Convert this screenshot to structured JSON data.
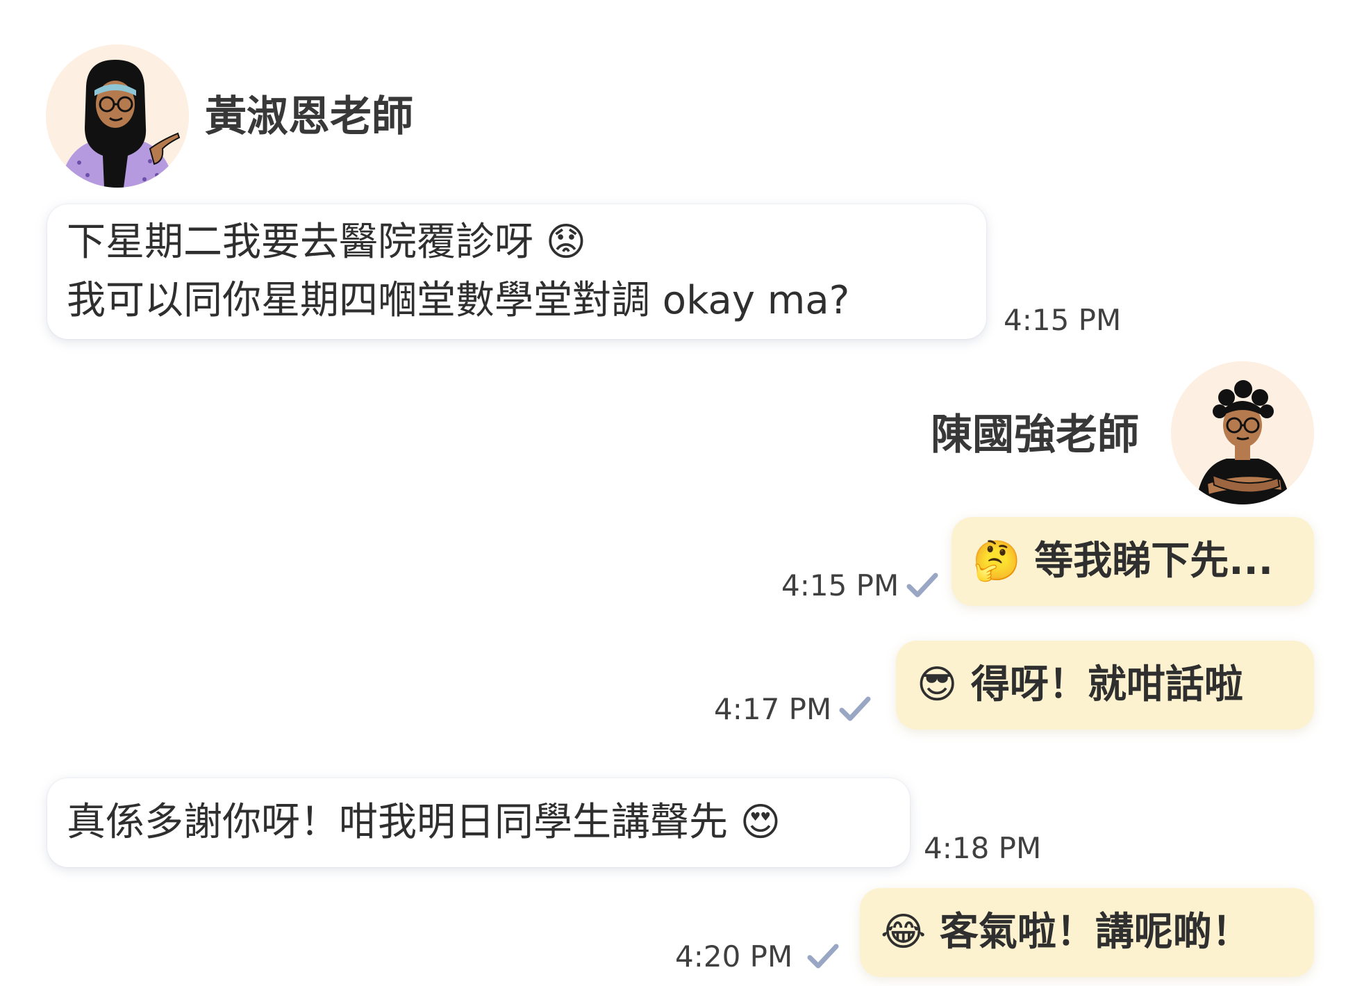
{
  "contacts": {
    "teacher_wong": {
      "name": "黃淑恩老師",
      "avatar_icon": "woman-hijab-pointing-avatar-icon"
    },
    "teacher_chan": {
      "name": "陳國強老師",
      "avatar_icon": "man-arms-crossed-avatar-icon"
    }
  },
  "messages": [
    {
      "direction": "incoming",
      "sender": "黃淑恩老師",
      "lines": [
        "下星期二我要去醫院覆診呀 😟",
        "我可以同你星期四嗰堂數學堂對調 okay ma?"
      ],
      "time": "4:15 PM"
    },
    {
      "direction": "outgoing",
      "sender": "陳國強老師",
      "text": "🤔 等我睇下先...",
      "time": "4:15 PM",
      "status_icon": "sent-check-icon"
    },
    {
      "direction": "outgoing",
      "text": "😎 得呀！就咁話啦",
      "time": "4:17 PM",
      "status_icon": "sent-check-icon"
    },
    {
      "direction": "incoming",
      "text": "真係多謝你呀！咁我明日同學生講聲先 😍",
      "time": "4:18 PM"
    },
    {
      "direction": "outgoing",
      "text": "😂 客氣啦！講呢啲！",
      "time": "4:20 PM",
      "status_icon": "sent-check-icon"
    }
  ],
  "colors": {
    "incoming_bubble": "#ffffff",
    "outgoing_bubble": "#fdf2cf",
    "avatar_background": "#fdf0e2",
    "check_mark": "#9aa7c4"
  }
}
